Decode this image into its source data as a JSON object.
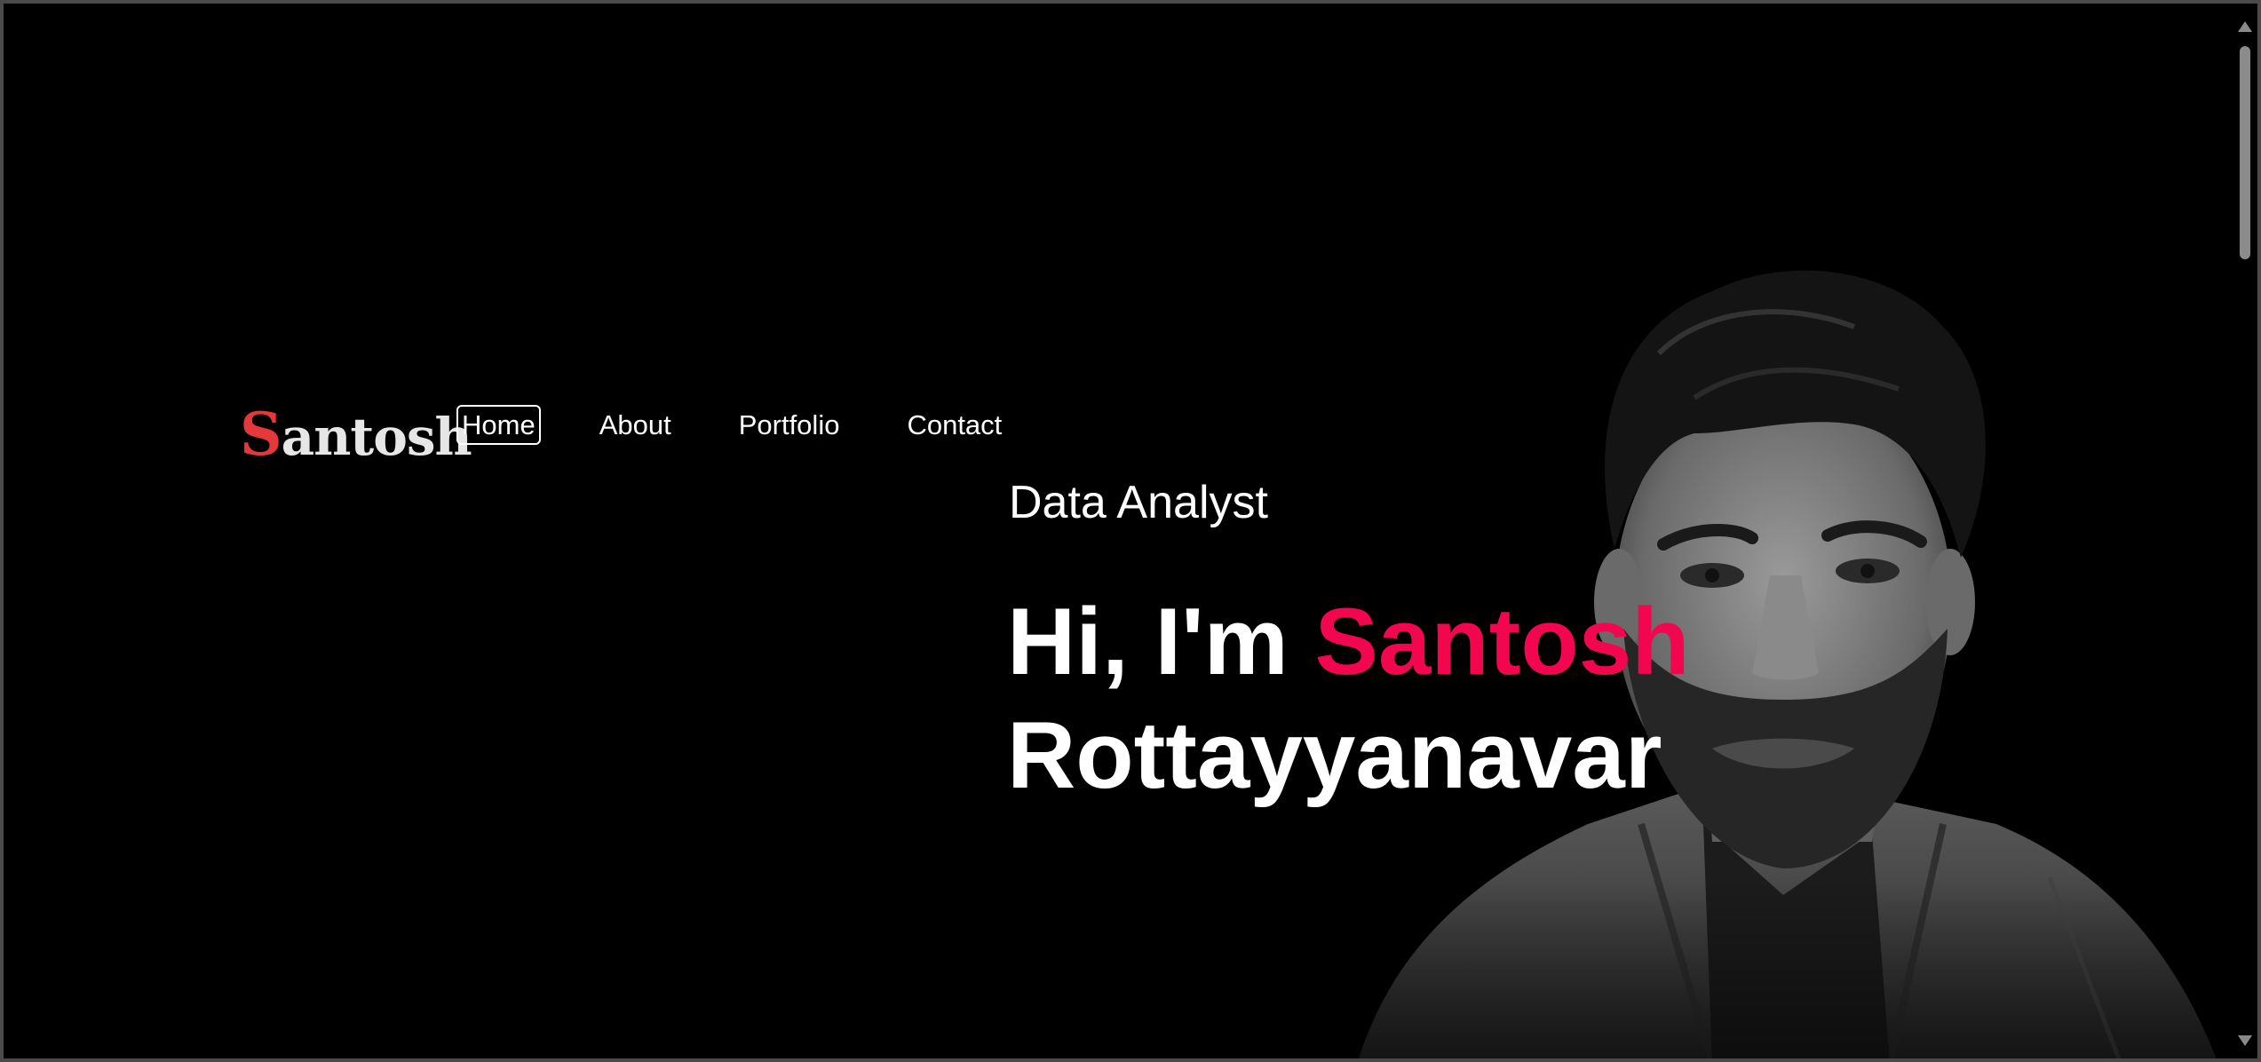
{
  "logo": {
    "first_letter": "S",
    "rest": "antosh"
  },
  "nav": {
    "items": [
      {
        "label": "Home",
        "active": true
      },
      {
        "label": "About",
        "active": false
      },
      {
        "label": "Portfolio",
        "active": false
      },
      {
        "label": "Contact",
        "active": false
      }
    ]
  },
  "hero": {
    "role": "Data Analyst",
    "greeting": "Hi, I'm ",
    "first_name": "Santosh",
    "last_name": "Rottayyanavar"
  },
  "colors": {
    "background": "#000000",
    "accent": "#f2064f",
    "logo_accent": "#e5383b",
    "text": "#ffffff"
  },
  "icons": {
    "scroll_up": "triangle-up",
    "scroll_down": "triangle-down"
  }
}
